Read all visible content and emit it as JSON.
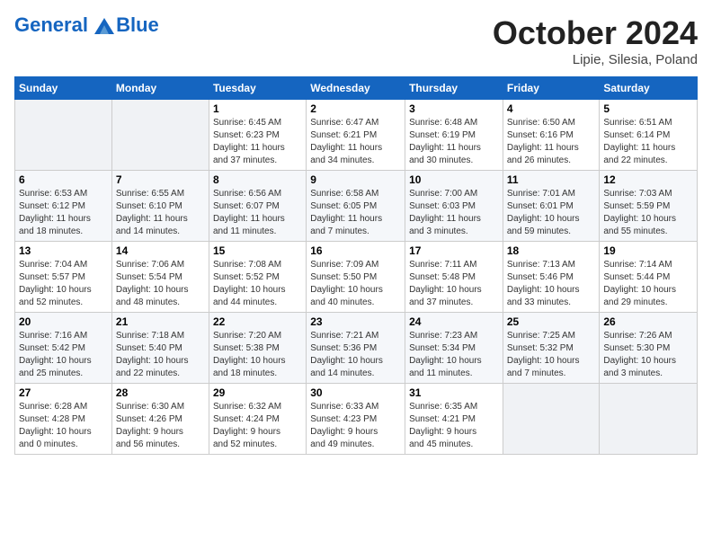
{
  "header": {
    "logo_line1": "General",
    "logo_line2": "Blue",
    "month": "October 2024",
    "location": "Lipie, Silesia, Poland"
  },
  "weekdays": [
    "Sunday",
    "Monday",
    "Tuesday",
    "Wednesday",
    "Thursday",
    "Friday",
    "Saturday"
  ],
  "weeks": [
    [
      {
        "day": "",
        "info": ""
      },
      {
        "day": "",
        "info": ""
      },
      {
        "day": "1",
        "info": "Sunrise: 6:45 AM\nSunset: 6:23 PM\nDaylight: 11 hours\nand 37 minutes."
      },
      {
        "day": "2",
        "info": "Sunrise: 6:47 AM\nSunset: 6:21 PM\nDaylight: 11 hours\nand 34 minutes."
      },
      {
        "day": "3",
        "info": "Sunrise: 6:48 AM\nSunset: 6:19 PM\nDaylight: 11 hours\nand 30 minutes."
      },
      {
        "day": "4",
        "info": "Sunrise: 6:50 AM\nSunset: 6:16 PM\nDaylight: 11 hours\nand 26 minutes."
      },
      {
        "day": "5",
        "info": "Sunrise: 6:51 AM\nSunset: 6:14 PM\nDaylight: 11 hours\nand 22 minutes."
      }
    ],
    [
      {
        "day": "6",
        "info": "Sunrise: 6:53 AM\nSunset: 6:12 PM\nDaylight: 11 hours\nand 18 minutes."
      },
      {
        "day": "7",
        "info": "Sunrise: 6:55 AM\nSunset: 6:10 PM\nDaylight: 11 hours\nand 14 minutes."
      },
      {
        "day": "8",
        "info": "Sunrise: 6:56 AM\nSunset: 6:07 PM\nDaylight: 11 hours\nand 11 minutes."
      },
      {
        "day": "9",
        "info": "Sunrise: 6:58 AM\nSunset: 6:05 PM\nDaylight: 11 hours\nand 7 minutes."
      },
      {
        "day": "10",
        "info": "Sunrise: 7:00 AM\nSunset: 6:03 PM\nDaylight: 11 hours\nand 3 minutes."
      },
      {
        "day": "11",
        "info": "Sunrise: 7:01 AM\nSunset: 6:01 PM\nDaylight: 10 hours\nand 59 minutes."
      },
      {
        "day": "12",
        "info": "Sunrise: 7:03 AM\nSunset: 5:59 PM\nDaylight: 10 hours\nand 55 minutes."
      }
    ],
    [
      {
        "day": "13",
        "info": "Sunrise: 7:04 AM\nSunset: 5:57 PM\nDaylight: 10 hours\nand 52 minutes."
      },
      {
        "day": "14",
        "info": "Sunrise: 7:06 AM\nSunset: 5:54 PM\nDaylight: 10 hours\nand 48 minutes."
      },
      {
        "day": "15",
        "info": "Sunrise: 7:08 AM\nSunset: 5:52 PM\nDaylight: 10 hours\nand 44 minutes."
      },
      {
        "day": "16",
        "info": "Sunrise: 7:09 AM\nSunset: 5:50 PM\nDaylight: 10 hours\nand 40 minutes."
      },
      {
        "day": "17",
        "info": "Sunrise: 7:11 AM\nSunset: 5:48 PM\nDaylight: 10 hours\nand 37 minutes."
      },
      {
        "day": "18",
        "info": "Sunrise: 7:13 AM\nSunset: 5:46 PM\nDaylight: 10 hours\nand 33 minutes."
      },
      {
        "day": "19",
        "info": "Sunrise: 7:14 AM\nSunset: 5:44 PM\nDaylight: 10 hours\nand 29 minutes."
      }
    ],
    [
      {
        "day": "20",
        "info": "Sunrise: 7:16 AM\nSunset: 5:42 PM\nDaylight: 10 hours\nand 25 minutes."
      },
      {
        "day": "21",
        "info": "Sunrise: 7:18 AM\nSunset: 5:40 PM\nDaylight: 10 hours\nand 22 minutes."
      },
      {
        "day": "22",
        "info": "Sunrise: 7:20 AM\nSunset: 5:38 PM\nDaylight: 10 hours\nand 18 minutes."
      },
      {
        "day": "23",
        "info": "Sunrise: 7:21 AM\nSunset: 5:36 PM\nDaylight: 10 hours\nand 14 minutes."
      },
      {
        "day": "24",
        "info": "Sunrise: 7:23 AM\nSunset: 5:34 PM\nDaylight: 10 hours\nand 11 minutes."
      },
      {
        "day": "25",
        "info": "Sunrise: 7:25 AM\nSunset: 5:32 PM\nDaylight: 10 hours\nand 7 minutes."
      },
      {
        "day": "26",
        "info": "Sunrise: 7:26 AM\nSunset: 5:30 PM\nDaylight: 10 hours\nand 3 minutes."
      }
    ],
    [
      {
        "day": "27",
        "info": "Sunrise: 6:28 AM\nSunset: 4:28 PM\nDaylight: 10 hours\nand 0 minutes."
      },
      {
        "day": "28",
        "info": "Sunrise: 6:30 AM\nSunset: 4:26 PM\nDaylight: 9 hours\nand 56 minutes."
      },
      {
        "day": "29",
        "info": "Sunrise: 6:32 AM\nSunset: 4:24 PM\nDaylight: 9 hours\nand 52 minutes."
      },
      {
        "day": "30",
        "info": "Sunrise: 6:33 AM\nSunset: 4:23 PM\nDaylight: 9 hours\nand 49 minutes."
      },
      {
        "day": "31",
        "info": "Sunrise: 6:35 AM\nSunset: 4:21 PM\nDaylight: 9 hours\nand 45 minutes."
      },
      {
        "day": "",
        "info": ""
      },
      {
        "day": "",
        "info": ""
      }
    ]
  ]
}
